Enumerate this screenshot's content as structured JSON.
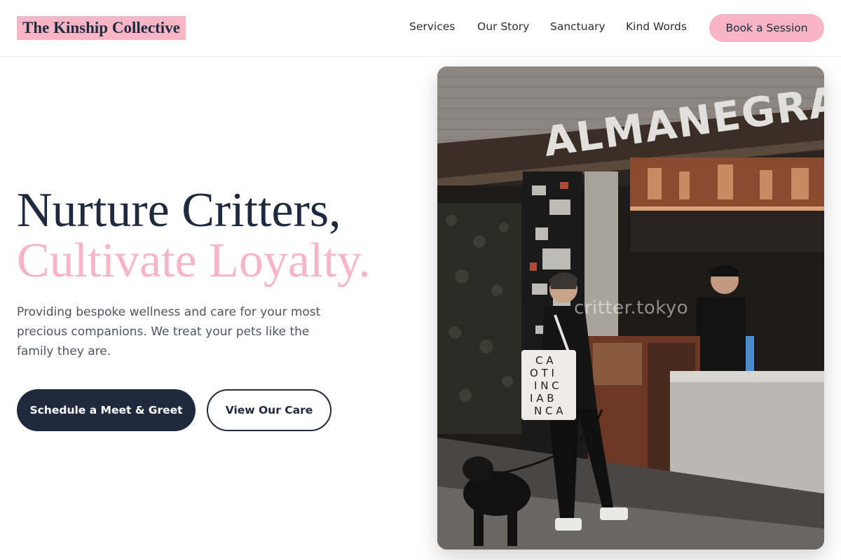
{
  "header": {
    "logo": "The Kinship Collective",
    "nav": [
      "Services",
      "Our Story",
      "Sanctuary",
      "Kind Words"
    ],
    "cta": "Book a Session"
  },
  "hero": {
    "headline_line1": "Nurture Critters,",
    "headline_line2": "Cultivate Loyalty.",
    "subtitle": "Providing bespoke wellness and care for your most precious companions. We treat your pets like the family they are.",
    "primary_button": "Schedule a Meet & Greet",
    "secondary_button": "View Our Care"
  },
  "photo": {
    "sign_text": "ALMANEGRA",
    "watermark": "critter.tokyo",
    "tote_letters": [
      "C A",
      "O T I",
      "I N C",
      "I A B",
      "N C A"
    ]
  },
  "colors": {
    "navy": "#1f2a3f",
    "pink": "#f7b5c6",
    "text_gray": "#4f5563"
  }
}
